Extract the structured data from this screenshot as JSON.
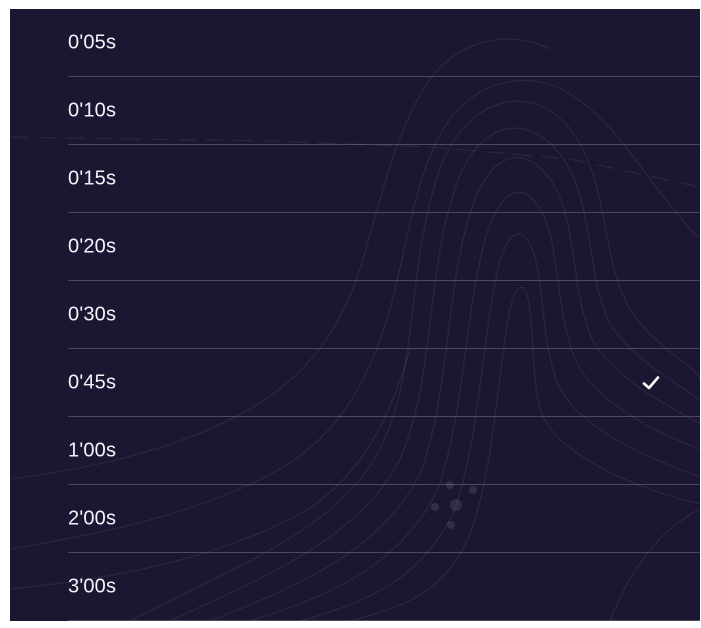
{
  "interval_list": {
    "options": [
      {
        "label": "0'05s",
        "selected": false
      },
      {
        "label": "0'10s",
        "selected": false
      },
      {
        "label": "0'15s",
        "selected": false
      },
      {
        "label": "0'20s",
        "selected": false
      },
      {
        "label": "0'30s",
        "selected": false
      },
      {
        "label": "0'45s",
        "selected": true
      },
      {
        "label": "1'00s",
        "selected": false
      },
      {
        "label": "2'00s",
        "selected": false
      },
      {
        "label": "3'00s",
        "selected": false
      }
    ],
    "selected_icon": "check-icon"
  },
  "colors": {
    "background": "#1b1631",
    "text": "#f4f3f8",
    "divider": "rgba(255,255,255,0.22)",
    "contour": "rgba(255,255,255,0.06)"
  }
}
